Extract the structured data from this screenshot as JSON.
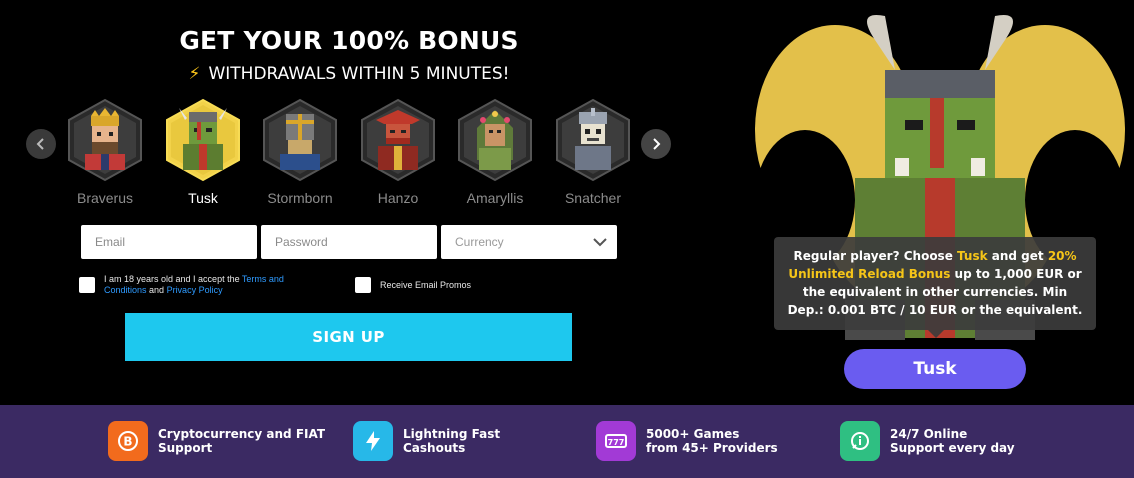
{
  "promo": {
    "headline": "GET YOUR 100% BONUS",
    "subline": "WITHDRAWALS WITHIN 5 MINUTES!",
    "bolt_icon": "lightning-icon"
  },
  "carousel": {
    "prev_icon": "chevron-left-icon",
    "next_icon": "chevron-right-icon",
    "selected": "Tusk",
    "heroes": [
      {
        "name": "Braverus",
        "active": false
      },
      {
        "name": "Tusk",
        "active": true
      },
      {
        "name": "Stormborn",
        "active": false
      },
      {
        "name": "Hanzo",
        "active": false
      },
      {
        "name": "Amaryllis",
        "active": false
      },
      {
        "name": "Snatcher",
        "active": false
      }
    ]
  },
  "form": {
    "email_placeholder": "Email",
    "password_placeholder": "Password",
    "currency_placeholder": "Currency",
    "terms_prefix": "I am 18 years old and I accept the ",
    "terms_link": "Terms and Conditions",
    "terms_and": " and ",
    "privacy_link": "Privacy Policy",
    "promos_label": "Receive Email Promos",
    "signup_label": "SIGN UP"
  },
  "tooltip": {
    "part1": "Regular player? Choose ",
    "hero": "Tusk",
    "part2": " and get ",
    "bonus": "20% Unlimited Reload Bonus",
    "part3": " up to 1,000 EUR or the equivalent in other currencies. Min Dep.: 0.001 BTC / 10 EUR or the equivalent."
  },
  "hero_button": "Tusk",
  "features": [
    {
      "icon": "bitcoin-icon",
      "line1": "Cryptocurrency and FIAT",
      "line2": "Support",
      "color": "#f26b1d"
    },
    {
      "icon": "lightning-icon",
      "line1": "Lightning Fast",
      "line2": "Cashouts",
      "color": "#27b8e8"
    },
    {
      "icon": "slot-machine-icon",
      "line1": "5000+ Games",
      "line2": "from 45+ Providers",
      "color": "#a23ad6"
    },
    {
      "icon": "support-chat-icon",
      "line1": "24/7 Online",
      "line2": "Support every day",
      "color": "#2fbf82"
    }
  ],
  "colors": {
    "accent_yellow": "#f5c518",
    "signup_cyan": "#1ec8ee",
    "pill_purple": "#6a5cf0",
    "footer_purple": "#3b2a63"
  }
}
